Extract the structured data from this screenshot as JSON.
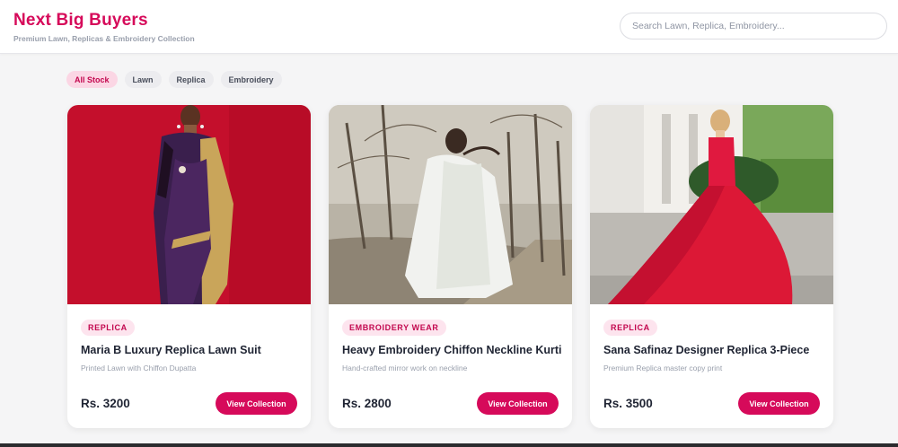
{
  "header": {
    "title": "Next Big Buyers",
    "subtitle": "Premium Lawn, Replicas & Embroidery Collection"
  },
  "search": {
    "placeholder": "Search Lawn, Replica, Embroidery..."
  },
  "filters": [
    {
      "label": "All Stock",
      "active": true
    },
    {
      "label": "Lawn",
      "active": false
    },
    {
      "label": "Replica",
      "active": false
    },
    {
      "label": "Embroidery",
      "active": false
    }
  ],
  "products": [
    {
      "badge": "REPLICA",
      "name": "Maria B Luxury Replica Lawn Suit",
      "description": "Printed Lawn with Chiffon Dupatta",
      "price": "Rs. 3200",
      "button": "View Collection",
      "image": "red-backdrop-purple-saree-photo"
    },
    {
      "badge": "EMBROIDERY WEAR",
      "name": "Heavy Embroidery Chiffon Neckline Kurti",
      "description": "Hand-crafted mirror work on neckline",
      "price": "Rs. 2800",
      "button": "View Collection",
      "image": "white-chiffon-outdoor-photo"
    },
    {
      "badge": "REPLICA",
      "name": "Sana Safinaz Designer Replica 3-Piece",
      "description": "Premium Replica master copy print",
      "price": "Rs. 3500",
      "button": "View Collection",
      "image": "red-gown-garden-photo"
    }
  ],
  "colors": {
    "brand": "#d60a5a",
    "badge_bg": "#fde4ee",
    "chip_active_bg": "#fbd6e4"
  }
}
